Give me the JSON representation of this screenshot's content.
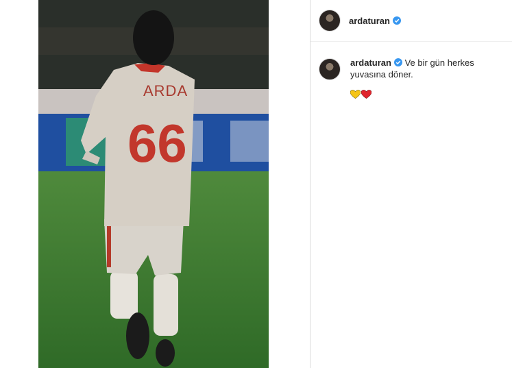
{
  "post": {
    "author": "ardaturan",
    "author_verified": true,
    "caption": "Ve bir gün herkes yuvasına döner.",
    "hearts": [
      {
        "name": "yellow-heart-icon",
        "color": "#f5c518"
      },
      {
        "name": "red-heart-icon",
        "color": "#e0242c"
      }
    ]
  },
  "photo": {
    "jersey_name": "ARDA",
    "jersey_number": "66"
  },
  "colors": {
    "verified_blue": "#3897f0",
    "text": "#262626",
    "divider": "#dbdbdb"
  }
}
